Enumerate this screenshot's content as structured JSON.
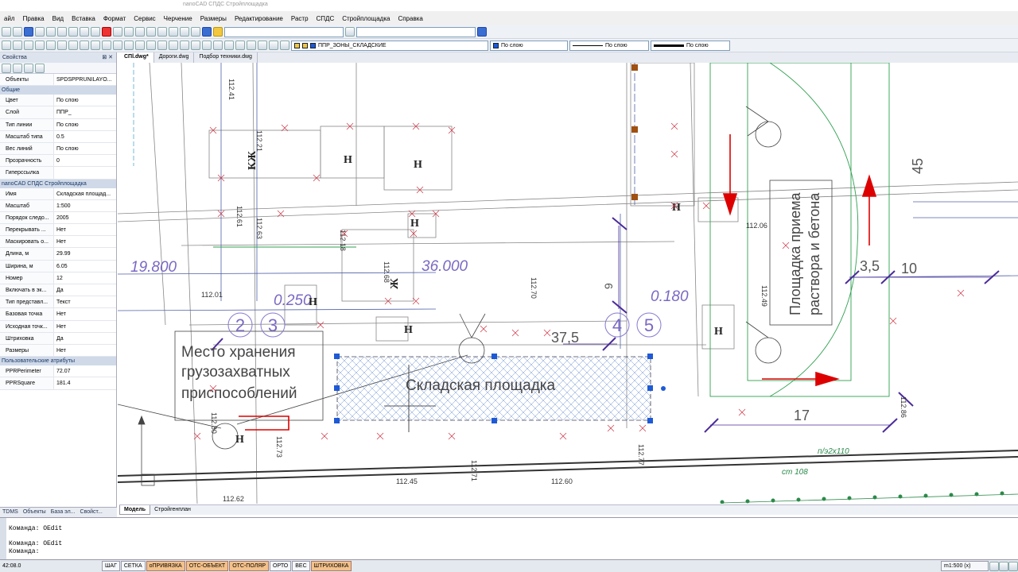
{
  "title": "nanoCAD СПДС Стройплощадка",
  "menu": [
    "айл",
    "Правка",
    "Вид",
    "Вставка",
    "Формат",
    "Сервис",
    "Черчение",
    "Размеры",
    "Редактирование",
    "Растр",
    "СПДС",
    "Стройплощадка",
    "Справка"
  ],
  "toolbar": {
    "layer": "ППР_ЗОНЫ_СКЛАДСКИЕ",
    "color": "По слою",
    "linetype": "По слою",
    "lineweight": "По слою"
  },
  "panel": {
    "header": "Свойства",
    "object_label": "Объекты",
    "object_value": "SPDSPPRUNILAYO...",
    "sec_general": "Общие",
    "general": [
      [
        "Цвет",
        "По слою"
      ],
      [
        "Слой",
        "ППР_"
      ],
      [
        "Тип линии",
        "По слою"
      ],
      [
        "Масштаб типа",
        "0.5"
      ],
      [
        "Вес линий",
        "По слою"
      ],
      [
        "Прозрачность",
        "0"
      ],
      [
        "Гиперссылка",
        ""
      ]
    ],
    "sec_spds": "nanoCAD СПДС Стройплощадка",
    "spds": [
      [
        "Имя",
        "Складская площад..."
      ],
      [
        "Масштаб",
        "1:500"
      ],
      [
        "Порядок следо...",
        "2005"
      ],
      [
        "Перекрывать ...",
        "Нет"
      ],
      [
        "Маскировать о...",
        "Нет"
      ],
      [
        "Длина, м",
        "29.99"
      ],
      [
        "Ширина, м",
        "6.05"
      ],
      [
        "Номер",
        "12"
      ],
      [
        "Включать в эк...",
        "Да"
      ],
      [
        "Тип представл...",
        "Текст"
      ],
      [
        "Базовая точка",
        "Нет"
      ],
      [
        "Исходная точк...",
        "Нет"
      ],
      [
        "Штриховка",
        "Да"
      ],
      [
        "Размеры",
        "Нет"
      ]
    ],
    "sec_user": "Пользовательские атрибуты",
    "user": [
      [
        "PPRPerimeter",
        "72.07"
      ],
      [
        "PPRSquare",
        "181.4"
      ]
    ],
    "tabs": [
      "TDMS",
      "Объекты",
      "База эл...",
      "Свойст..."
    ]
  },
  "doc_tabs": [
    "СПl.dwg*",
    "Дороги.dwg",
    "Подбор техники.dwg"
  ],
  "layout_tabs": [
    "Модель",
    "Стройгенплан"
  ],
  "drawing": {
    "elev1": "19.800",
    "elev2": "36.000",
    "elev3": "0.250",
    "elev4": "0.180",
    "dim1": "37,5",
    "dim2": "17",
    "dim3": "3,5",
    "dim4": "10",
    "dim5": "45",
    "dim6": "9",
    "label_store": "Место хранения грузозахватных приспособлений",
    "label_site": "Складская площадка",
    "label_pad": "Площадка приема раствора и бетона",
    "n2": "2",
    "n3": "3",
    "n4": "4",
    "n5": "5",
    "h": "Н",
    "kzh": "КЖ",
    "zh": "Ж",
    "pipe": "п/э2х110",
    "ct": "ст 108",
    "marks": [
      "112.41",
      "112.21",
      "112.61",
      "112.63",
      "112.18",
      "112.68",
      "112.70",
      "112.01",
      "112.80",
      "112.73",
      "112.45",
      "112.71",
      "112.60",
      "112.77",
      "112.06",
      "112.49",
      "112.86",
      "112.62"
    ]
  },
  "command": [
    "Команда: OEdit",
    "Команда: OEdit",
    "Команда:"
  ],
  "status": {
    "coords": "42:08.0",
    "buttons": [
      "ШАГ",
      "СЕТКА",
      "оПРИВЯЗКА",
      "ОТС-ОБЪЕКТ",
      "ОТС-ПОЛЯР",
      "ОРТО",
      "ВЕС",
      "ШТРИХОВКА"
    ],
    "scale": "m1:500 (x)"
  }
}
